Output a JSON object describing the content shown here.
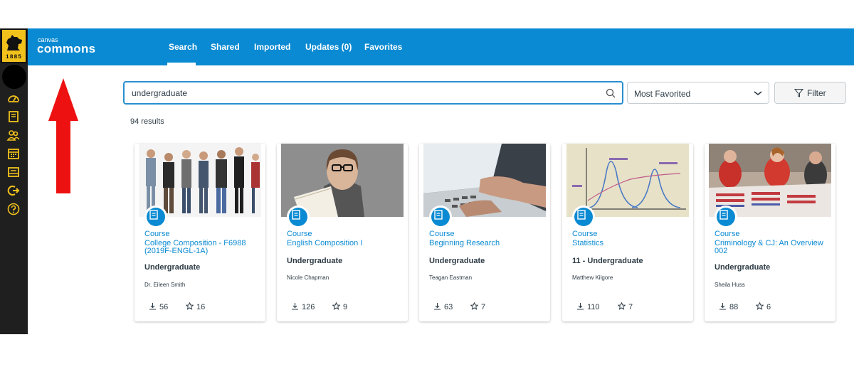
{
  "brand": {
    "small": "canvas",
    "big": "commons"
  },
  "logo": {
    "year": "1885"
  },
  "tabs": [
    {
      "label": "Search"
    },
    {
      "label": "Shared"
    },
    {
      "label": "Imported"
    },
    {
      "label": "Updates (0)"
    },
    {
      "label": "Favorites"
    }
  ],
  "search": {
    "value": "undergraduate",
    "placeholder": ""
  },
  "sort": {
    "selected": "Most Favorited"
  },
  "filter": {
    "label": "Filter"
  },
  "results": {
    "count_label": "94 results"
  },
  "colors": {
    "accent": "#0a8ad2",
    "rail": "#1f1f1f",
    "rail_icon": "#f2c21c",
    "arrow": "#ee1111"
  },
  "cards": [
    {
      "type": "Course",
      "title": "College Composition - F6988 (2019F-ENGL-1A)",
      "level": "Undergraduate",
      "author": "Dr. Eileen Smith",
      "downloads": "56",
      "favorites": "16"
    },
    {
      "type": "Course",
      "title": "English Composition I",
      "level": "Undergraduate",
      "author": "Nicole Chapman",
      "downloads": "126",
      "favorites": "9"
    },
    {
      "type": "Course",
      "title": "Beginning Research",
      "level": "Undergraduate",
      "author": "Teagan Eastman",
      "downloads": "63",
      "favorites": "7"
    },
    {
      "type": "Course",
      "title": "Statistics",
      "level": "11 - Undergraduate",
      "author": "Matthew Kilgore",
      "downloads": "110",
      "favorites": "7"
    },
    {
      "type": "Course",
      "title": "Criminology & CJ: An Overview 002",
      "level": "Undergraduate",
      "author": "Sheila Huss",
      "downloads": "88",
      "favorites": "6"
    }
  ]
}
